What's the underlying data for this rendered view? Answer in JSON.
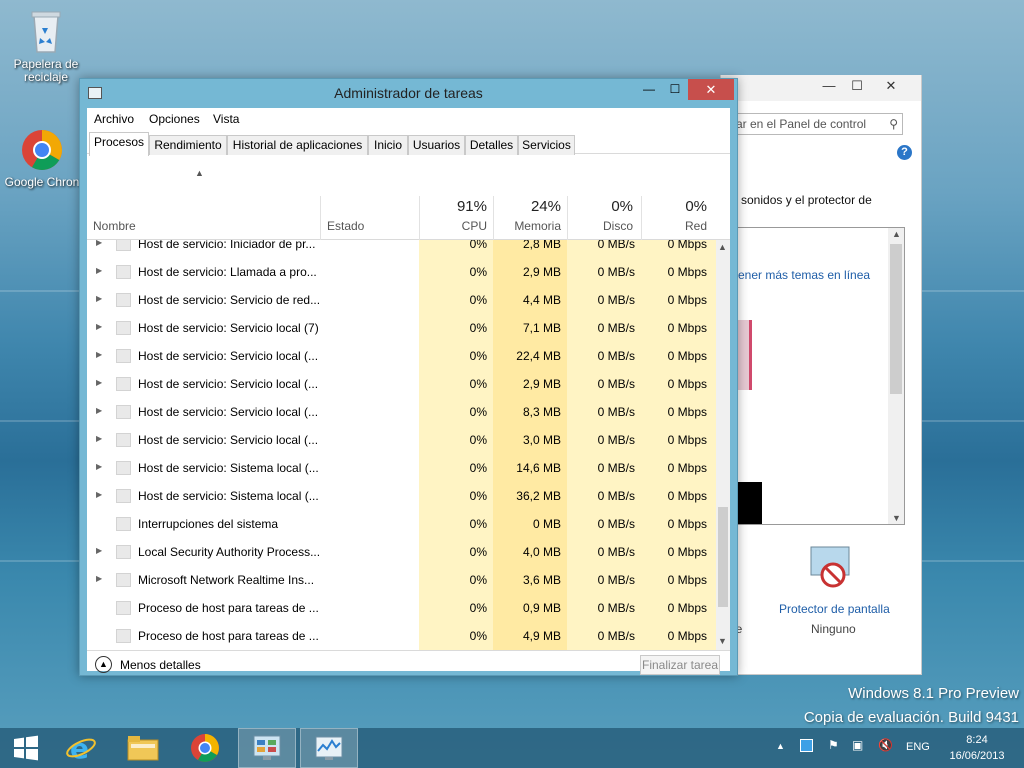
{
  "desktop": {
    "icons": [
      {
        "label": "Papelera de reciclaje"
      },
      {
        "label": "Google Chron"
      }
    ],
    "watermark": {
      "line1": "Windows 8.1 Pro Preview",
      "line2": "Copia de evaluación. Build 9431"
    }
  },
  "control_panel": {
    "title_controls": {
      "minimize": "—",
      "maximize": "☐",
      "close": "✕"
    },
    "search_placeholder": "ar en el Panel de control",
    "help": "?",
    "text": "sonidos y el protector de",
    "link": "ener más temas en línea",
    "screensaver_label": "Protector de pantalla",
    "screensaver_value": "Ninguno",
    "side_fragment": "le"
  },
  "task_manager": {
    "title": "Administrador de tareas",
    "controls": {
      "minimize": "—",
      "maximize": "☐",
      "close": "✕"
    },
    "menu": [
      "Archivo",
      "Opciones",
      "Vista"
    ],
    "tabs": [
      "Procesos",
      "Rendimiento",
      "Historial de aplicaciones",
      "Inicio",
      "Usuarios",
      "Detalles",
      "Servicios"
    ],
    "active_tab": "Procesos",
    "columns": {
      "name": "Nombre",
      "status": "Estado",
      "cpu": {
        "percent": "91%",
        "label": "CPU"
      },
      "memory": {
        "percent": "24%",
        "label": "Memoria"
      },
      "disk": {
        "percent": "0%",
        "label": "Disco"
      },
      "network": {
        "percent": "0%",
        "label": "Red"
      }
    },
    "rows": [
      {
        "name": "Host de servicio: Iniciador de pr...",
        "cpu": "0%",
        "mem": "2,8 MB",
        "disk": "0 MB/s",
        "net": "0 Mbps",
        "expandable": true
      },
      {
        "name": "Host de servicio: Llamada a pro...",
        "cpu": "0%",
        "mem": "2,9 MB",
        "disk": "0 MB/s",
        "net": "0 Mbps",
        "expandable": true
      },
      {
        "name": "Host de servicio: Servicio de red...",
        "cpu": "0%",
        "mem": "4,4 MB",
        "disk": "0 MB/s",
        "net": "0 Mbps",
        "expandable": true
      },
      {
        "name": "Host de servicio: Servicio local (7)",
        "cpu": "0%",
        "mem": "7,1 MB",
        "disk": "0 MB/s",
        "net": "0 Mbps",
        "expandable": true
      },
      {
        "name": "Host de servicio: Servicio local (...",
        "cpu": "0%",
        "mem": "22,4 MB",
        "disk": "0 MB/s",
        "net": "0 Mbps",
        "expandable": true
      },
      {
        "name": "Host de servicio: Servicio local (...",
        "cpu": "0%",
        "mem": "2,9 MB",
        "disk": "0 MB/s",
        "net": "0 Mbps",
        "expandable": true
      },
      {
        "name": "Host de servicio: Servicio local (...",
        "cpu": "0%",
        "mem": "8,3 MB",
        "disk": "0 MB/s",
        "net": "0 Mbps",
        "expandable": true
      },
      {
        "name": "Host de servicio: Servicio local (...",
        "cpu": "0%",
        "mem": "3,0 MB",
        "disk": "0 MB/s",
        "net": "0 Mbps",
        "expandable": true
      },
      {
        "name": "Host de servicio: Sistema local (...",
        "cpu": "0%",
        "mem": "14,6 MB",
        "disk": "0 MB/s",
        "net": "0 Mbps",
        "expandable": true
      },
      {
        "name": "Host de servicio: Sistema local (...",
        "cpu": "0%",
        "mem": "36,2 MB",
        "disk": "0 MB/s",
        "net": "0 Mbps",
        "expandable": true
      },
      {
        "name": "Interrupciones del sistema",
        "cpu": "0%",
        "mem": "0 MB",
        "disk": "0 MB/s",
        "net": "0 Mbps",
        "expandable": false
      },
      {
        "name": "Local Security Authority Process...",
        "cpu": "0%",
        "mem": "4,0 MB",
        "disk": "0 MB/s",
        "net": "0 Mbps",
        "expandable": true
      },
      {
        "name": "Microsoft Network Realtime Ins...",
        "cpu": "0%",
        "mem": "3,6 MB",
        "disk": "0 MB/s",
        "net": "0 Mbps",
        "expandable": true
      },
      {
        "name": "Proceso de host para tareas de ...",
        "cpu": "0%",
        "mem": "0,9 MB",
        "disk": "0 MB/s",
        "net": "0 Mbps",
        "expandable": false
      },
      {
        "name": "Proceso de host para tareas de ...",
        "cpu": "0%",
        "mem": "4,9 MB",
        "disk": "0 MB/s",
        "net": "0 Mbps",
        "expandable": false
      }
    ],
    "footer": {
      "less_details": "Menos detalles",
      "end_task": "Finalizar tarea"
    }
  },
  "taskbar": {
    "language": "ENG",
    "time": "8:24",
    "date": "16/06/2013"
  },
  "colors": {
    "accent": "#75b8d4",
    "close_red": "#c74f4c",
    "heat_light": "#fff4c4",
    "heat_medium": "#ffeaa3",
    "link_blue": "#1f5ea8"
  }
}
